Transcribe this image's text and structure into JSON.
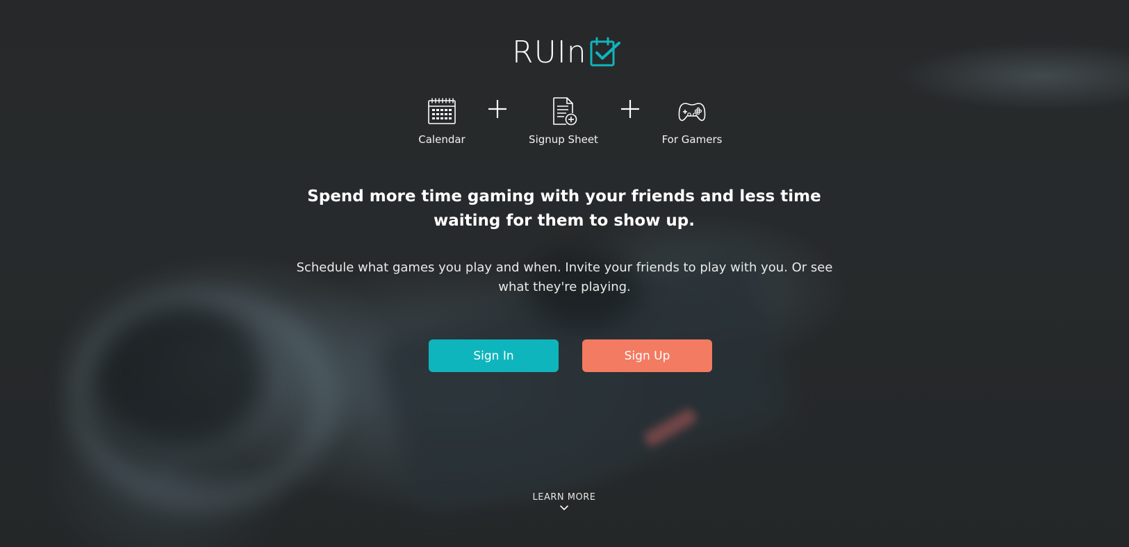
{
  "brand": {
    "logo_text": "RUIn",
    "logo_icon": "calendar-check-icon",
    "accent_color": "#0fb5bd",
    "secondary_color": "#f37b62"
  },
  "features": [
    {
      "label": "Calendar",
      "icon": "calendar-icon"
    },
    {
      "label": "Signup Sheet",
      "icon": "signup-sheet-icon"
    },
    {
      "label": "For Gamers",
      "icon": "gamepad-icon"
    }
  ],
  "hero": {
    "headline": "Spend more time gaming with your friends and less time waiting for them to show up.",
    "subtext": "Schedule what games you play and when. Invite your friends to play with you. Or see what they're playing."
  },
  "actions": {
    "sign_in_label": "Sign In",
    "sign_up_label": "Sign Up"
  },
  "learn_more": {
    "label": "LEARN MORE",
    "icon": "chevron-down-icon"
  }
}
